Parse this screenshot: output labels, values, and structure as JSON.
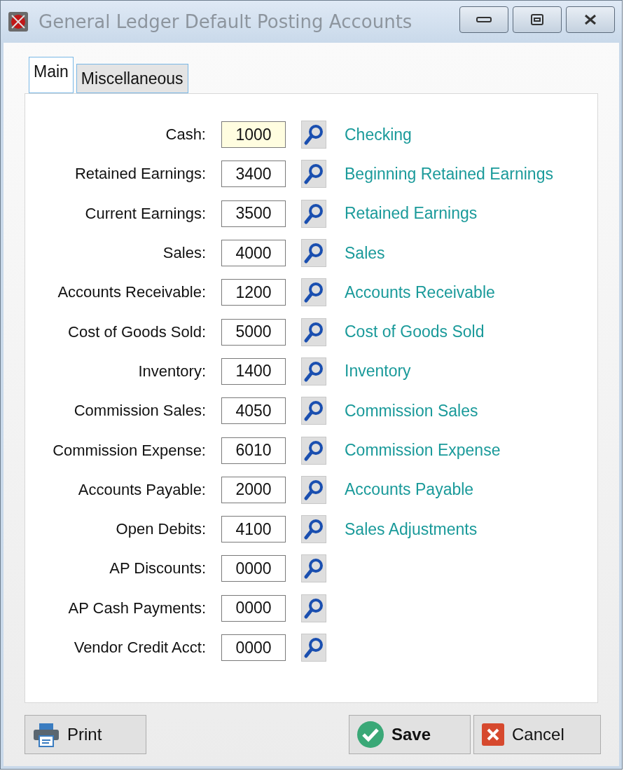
{
  "window": {
    "title": "General Ledger Default Posting Accounts"
  },
  "tabs": [
    {
      "label": "Main",
      "selected": true
    },
    {
      "label": "Miscellaneous",
      "selected": false
    }
  ],
  "accounts": [
    {
      "label": "Cash:",
      "value": "1000",
      "description": "Checking",
      "focused": true
    },
    {
      "label": "Retained Earnings:",
      "value": "3400",
      "description": "Beginning Retained Earnings",
      "focused": false
    },
    {
      "label": "Current Earnings:",
      "value": "3500",
      "description": "Retained Earnings",
      "focused": false
    },
    {
      "label": "Sales:",
      "value": "4000",
      "description": "Sales",
      "focused": false
    },
    {
      "label": "Accounts Receivable:",
      "value": "1200",
      "description": "Accounts Receivable",
      "focused": false
    },
    {
      "label": "Cost of Goods Sold:",
      "value": "5000",
      "description": "Cost of Goods Sold",
      "focused": false
    },
    {
      "label": "Inventory:",
      "value": "1400",
      "description": "Inventory",
      "focused": false
    },
    {
      "label": "Commission Sales:",
      "value": "4050",
      "description": "Commission Sales",
      "focused": false
    },
    {
      "label": "Commission Expense:",
      "value": "6010",
      "description": "Commission Expense",
      "focused": false
    },
    {
      "label": "Accounts Payable:",
      "value": "2000",
      "description": "Accounts Payable",
      "focused": false
    },
    {
      "label": "Open Debits:",
      "value": "4100",
      "description": "Sales Adjustments",
      "focused": false
    },
    {
      "label": "AP Discounts:",
      "value": "0000",
      "focused": false
    },
    {
      "label": "AP Cash Payments:",
      "value": "0000",
      "focused": false
    },
    {
      "label": "Vendor Credit Acct:",
      "value": "0000",
      "focused": false
    }
  ],
  "buttons": [
    {
      "kind": "print",
      "label": "Print"
    },
    {
      "kind": "save",
      "label": "Save"
    },
    {
      "kind": "cancel",
      "label": "Cancel"
    }
  ]
}
